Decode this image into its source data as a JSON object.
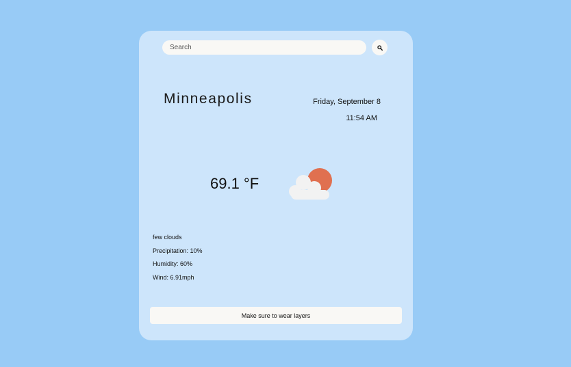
{
  "search": {
    "placeholder": "Search",
    "button_icon": "search-icon"
  },
  "location": {
    "city": "Minneapolis"
  },
  "datetime": {
    "date": "Friday, September 8",
    "time": "11:54 AM"
  },
  "weather": {
    "temperature": "69.1 °F",
    "icon": "few-clouds-icon",
    "description": "few clouds",
    "precipitation": "Precipitation: 10%",
    "humidity": "Humidity: 60%",
    "wind": "Wind: 6.91mph"
  },
  "advice": {
    "text": "Make sure to wear layers"
  },
  "colors": {
    "background": "#98cbf6",
    "card": "#cde5fb",
    "input": "#f9f8f5",
    "sun": "#e07050",
    "cloud": "#f2f2f2"
  }
}
